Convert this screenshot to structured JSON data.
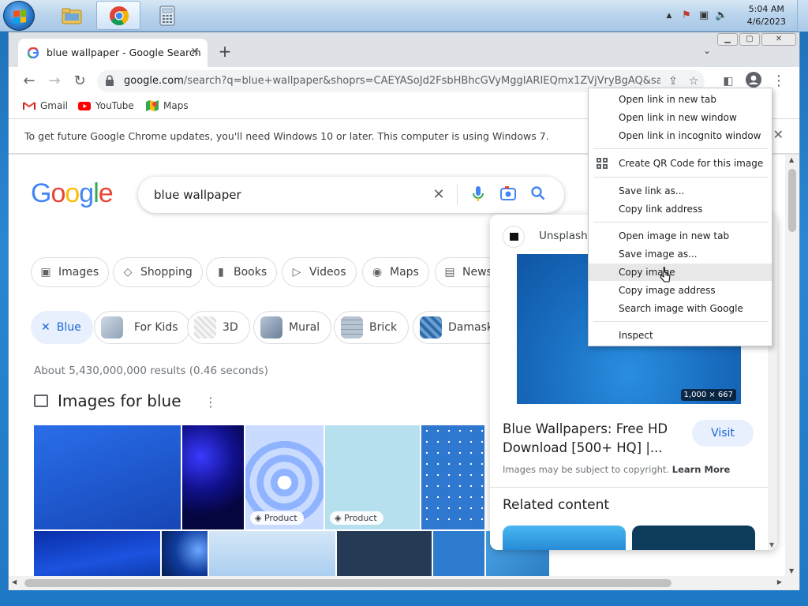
{
  "taskbar": {
    "apps": [
      "file-explorer",
      "chrome",
      "calculator"
    ],
    "clock_time": "5:04 AM",
    "clock_date": "4/6/2023"
  },
  "window": {
    "tab_title": "blue wallpaper - Google Search",
    "url_host": "google.com",
    "url_rest": "/search?q=blue+wallpaper&shoprs=CAEYASoJd2FsbHBhcGVyMggIARIEQmx1ZVjVryBgAQ&sa=...",
    "bookmarks": [
      "Gmail",
      "YouTube",
      "Maps"
    ],
    "infobar_message": "To get future Google Chrome updates, you'll need Windows 10 or later. This computer is using Windows 7."
  },
  "search": {
    "query": "blue wallpaper",
    "tabs": [
      "Images",
      "Shopping",
      "Books",
      "Videos",
      "Maps",
      "News"
    ],
    "filters": [
      "Blue",
      "For Kids",
      "3D",
      "Mural",
      "Brick",
      "Damask"
    ],
    "results_count": "About 5,430,000,000 results (0.46 seconds)",
    "images_heading": "Images for blue",
    "product_badge": "Product"
  },
  "panel": {
    "source": "Unsplash",
    "dimensions": "1,000 × 667",
    "title": "Blue Wallpapers: Free HD Download [500+ HQ] |...",
    "visit_label": "Visit",
    "copyright_text": "Images may be subject to copyright.",
    "learn_more": "Learn More",
    "related_heading": "Related content"
  },
  "context_menu": {
    "items": [
      "Open link in new tab",
      "Open link in new window",
      "Open link in incognito window",
      "Create QR Code for this image",
      "Save link as...",
      "Copy link address",
      "Open image in new tab",
      "Save image as...",
      "Copy image",
      "Copy image address",
      "Search image with Google",
      "Inspect"
    ],
    "highlighted": "Copy image"
  },
  "colors": {
    "google_blue": "#4285f4",
    "google_red": "#ea4335",
    "google_yellow": "#fbbc05",
    "google_green": "#34a853",
    "selected_chip_bg": "#e8f0fe",
    "link_blue": "#1967d2"
  }
}
